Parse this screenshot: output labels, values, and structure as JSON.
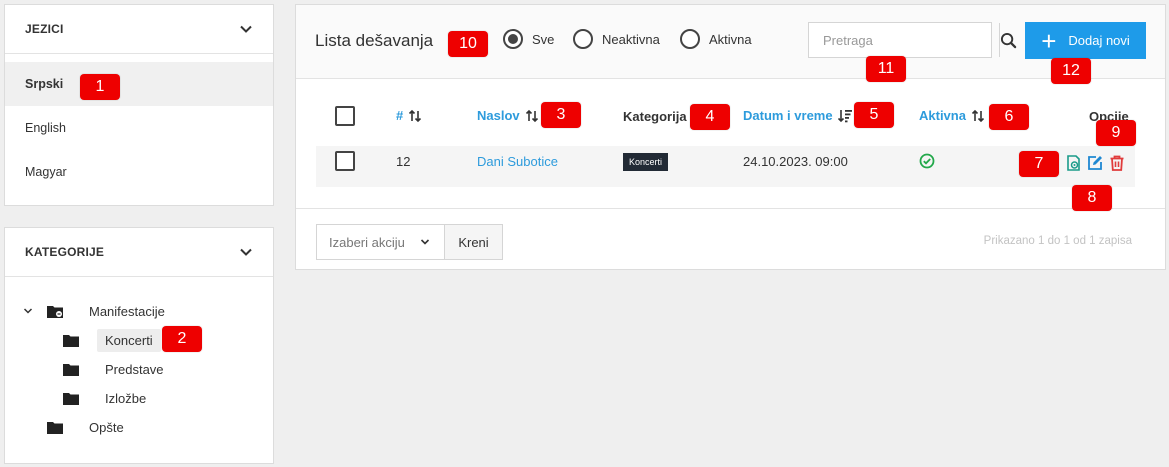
{
  "languages_panel": {
    "title": "JEZICI",
    "items": [
      {
        "label": "Srpski",
        "active": true
      },
      {
        "label": "English",
        "active": false
      },
      {
        "label": "Magyar",
        "active": false
      }
    ]
  },
  "categories_panel": {
    "title": "KATEGORIJE",
    "tree": [
      {
        "label": "Manifestacije",
        "expanded": true
      },
      {
        "label": "Koncerti",
        "selected": true
      },
      {
        "label": "Predstave"
      },
      {
        "label": "Izložbe"
      },
      {
        "label": "Opšte"
      }
    ]
  },
  "main": {
    "title": "Lista dešavanja",
    "filters": [
      {
        "label": "Sve",
        "checked": true
      },
      {
        "label": "Neaktivna",
        "checked": false
      },
      {
        "label": "Aktivna",
        "checked": false
      }
    ],
    "search": {
      "placeholder": "Pretraga"
    },
    "add_button": {
      "label": "Dodaj novi"
    },
    "table": {
      "headers": {
        "id": "#",
        "title": "Naslov",
        "category": "Kategorija",
        "datetime": "Datum i vreme",
        "active": "Aktivna",
        "options": "Opcije"
      },
      "rows": [
        {
          "id": "12",
          "title": "Dani Subotice",
          "category": "Koncerti",
          "datetime": "24.10.2023. 09:00",
          "active": true
        }
      ]
    },
    "bulk_action": {
      "placeholder": "Izaberi akciju",
      "go_label": "Kreni"
    },
    "summary": "Prikazano 1 do 1 od 1 zapisa"
  },
  "annotations": [
    "1",
    "2",
    "3",
    "4",
    "5",
    "6",
    "7",
    "8",
    "9",
    "10",
    "11",
    "12"
  ],
  "colors": {
    "accent": "#1e9be9",
    "link": "#2d9bdc",
    "badge": "#ee0000",
    "success": "#22a84a",
    "danger": "#e03b3b",
    "category_badge": "#222a35"
  }
}
